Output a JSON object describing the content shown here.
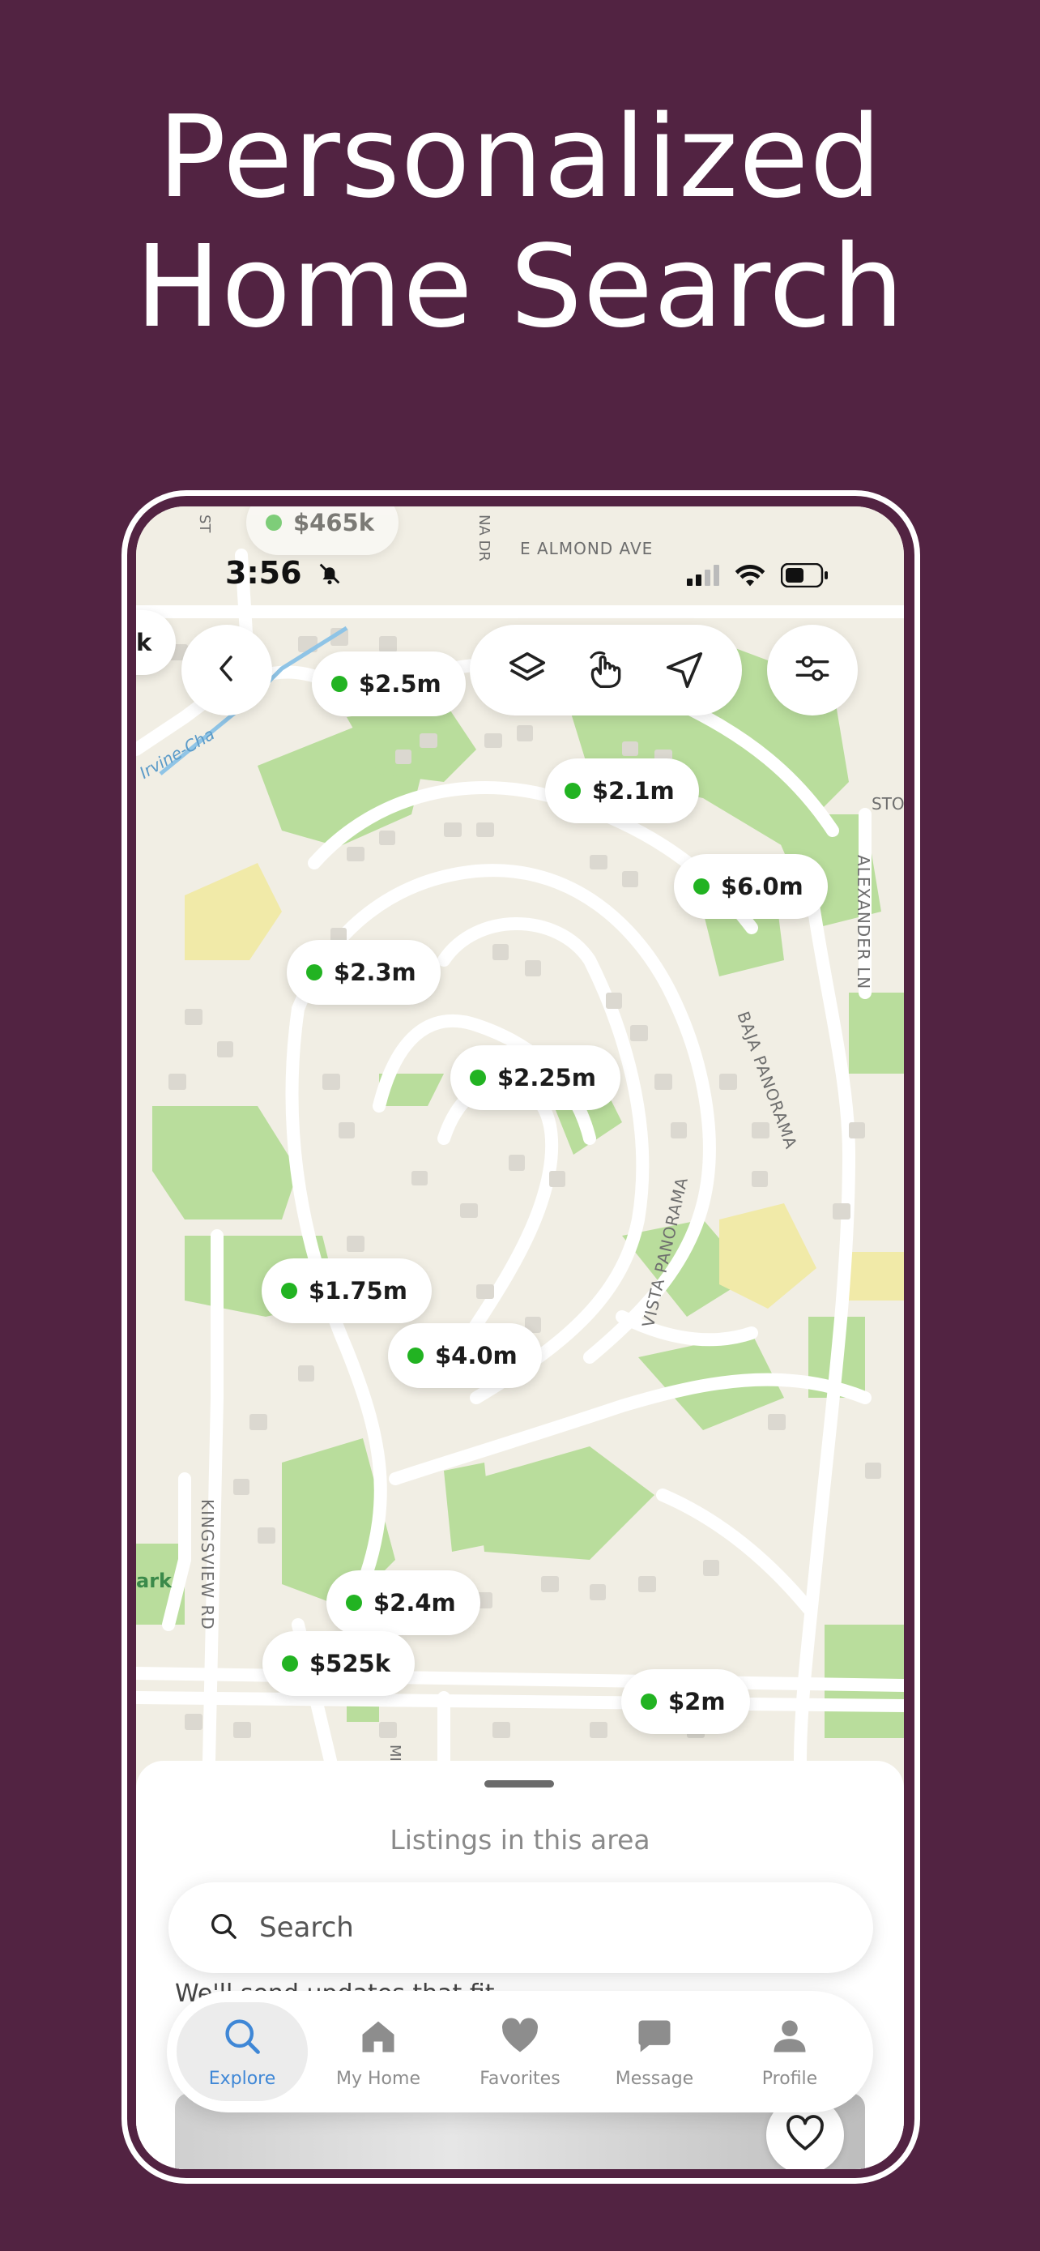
{
  "headline": {
    "line1": "Personalized",
    "line2": "Home Search"
  },
  "status_bar": {
    "time": "3:56"
  },
  "map": {
    "street_labels": [
      "E ALMOND AVE",
      "BAJA PANORAMA",
      "VISTA PANORAMA",
      "ALEXANDER LN",
      "KINGSVIEW RD",
      "Irvine-Cha",
      "STO",
      "ark",
      "NA DR",
      "ST",
      "MI"
    ],
    "top_pin_partial": "$465k",
    "left_pin_partial": "k",
    "price_pins": [
      "$2.5m",
      "$2.1m",
      "$6.0m",
      "$2.3m",
      "$2.25m",
      "$1.75m",
      "$4.0m",
      "$2.4m",
      "$525k",
      "$2m"
    ]
  },
  "controls": {
    "back_icon": "chevron-left-icon",
    "layers_icon": "layers-icon",
    "draw_icon": "hand-draw-icon",
    "locate_icon": "location-arrow-icon",
    "filter_icon": "sliders-icon"
  },
  "sheet": {
    "title": "Listings in this area",
    "search_placeholder": "Search",
    "subtext": "We'll send updates that fit."
  },
  "tabs": [
    {
      "label": "Explore",
      "icon": "search-icon",
      "active": true
    },
    {
      "label": "My Home",
      "icon": "home-icon",
      "active": false
    },
    {
      "label": "Favorites",
      "icon": "heart-icon",
      "active": false
    },
    {
      "label": "Message",
      "icon": "chat-bubble-icon",
      "active": false
    },
    {
      "label": "Profile",
      "icon": "person-icon",
      "active": false
    }
  ],
  "colors": {
    "background": "#522342",
    "price_dot": "#22b322",
    "active_tab": "#3f87d6",
    "park": "#b7dc9a",
    "land": "#f1eee4"
  }
}
